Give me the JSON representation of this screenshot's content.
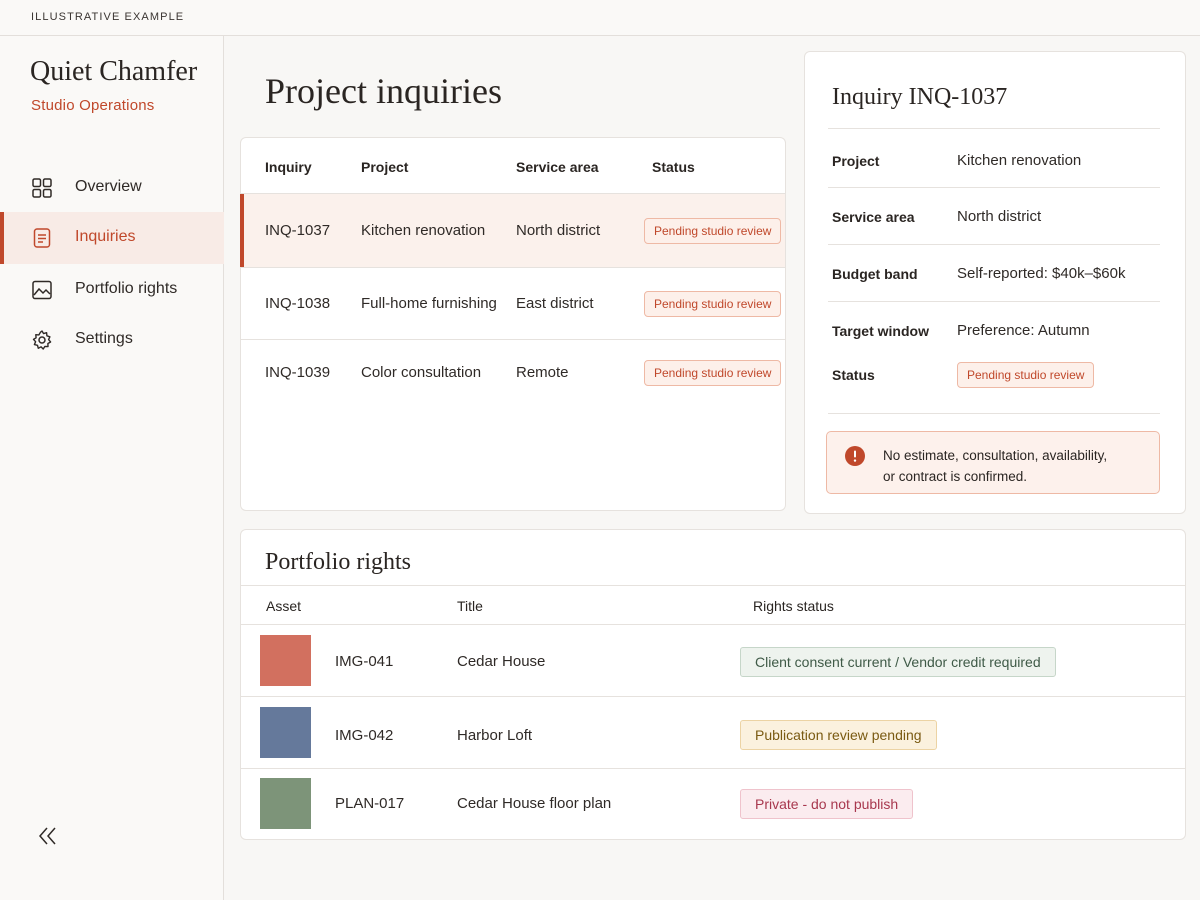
{
  "banner": {
    "label": "ILLUSTRATIVE EXAMPLE"
  },
  "brand": {
    "title": "Quiet Chamfer",
    "subtitle": "Studio Operations"
  },
  "sidebar": {
    "items": [
      {
        "label": "Overview",
        "icon": "grid-icon",
        "active": false
      },
      {
        "label": "Inquiries",
        "icon": "document-icon",
        "active": true
      },
      {
        "label": "Portfolio rights",
        "icon": "image-icon",
        "active": false
      },
      {
        "label": "Settings",
        "icon": "gear-icon",
        "active": false
      }
    ],
    "collapse_icon": "double-chevron-left-icon"
  },
  "page": {
    "title": "Project inquiries"
  },
  "inquiries": {
    "columns": [
      "Inquiry",
      "Project",
      "Service area",
      "Status"
    ],
    "rows": [
      {
        "id": "INQ-1037",
        "project": "Kitchen renovation",
        "area": "North district",
        "status": "Pending studio review",
        "selected": true
      },
      {
        "id": "INQ-1038",
        "project": "Full-home furnishing",
        "area": "East district",
        "status": "Pending studio review",
        "selected": false
      },
      {
        "id": "INQ-1039",
        "project": "Color consultation",
        "area": "Remote",
        "status": "Pending studio review",
        "selected": false
      }
    ]
  },
  "detail": {
    "title": "Inquiry INQ-1037",
    "fields": [
      {
        "label": "Project",
        "value": "Kitchen renovation"
      },
      {
        "label": "Service area",
        "value": "North district"
      },
      {
        "label": "Budget band",
        "value": "Self-reported: $40k–$60k"
      },
      {
        "label": "Target window",
        "value": "Preference: Autumn"
      }
    ],
    "status_label": "Status",
    "status_value": "Pending studio review",
    "alert": {
      "line1": "No estimate, consultation, availability,",
      "line2": "or contract is confirmed.",
      "icon": "alert-circle-icon"
    }
  },
  "portfolio": {
    "title": "Portfolio rights",
    "columns": [
      "Asset",
      "Title",
      "Rights status"
    ],
    "rows": [
      {
        "asset": "IMG-041",
        "title": "Cedar House",
        "rights": "Client consent current / Vendor credit required",
        "swatch": "#d2705f",
        "tone": "green"
      },
      {
        "asset": "IMG-042",
        "title": "Harbor Loft",
        "rights": "Publication review pending",
        "swatch": "#65799b",
        "tone": "amber"
      },
      {
        "asset": "PLAN-017",
        "title": "Cedar House floor plan",
        "rights": "Private - do not publish",
        "swatch": "#7d9479",
        "tone": "pink"
      }
    ]
  },
  "colors": {
    "accent": "#c0482b",
    "background": "#f8f7f5"
  }
}
